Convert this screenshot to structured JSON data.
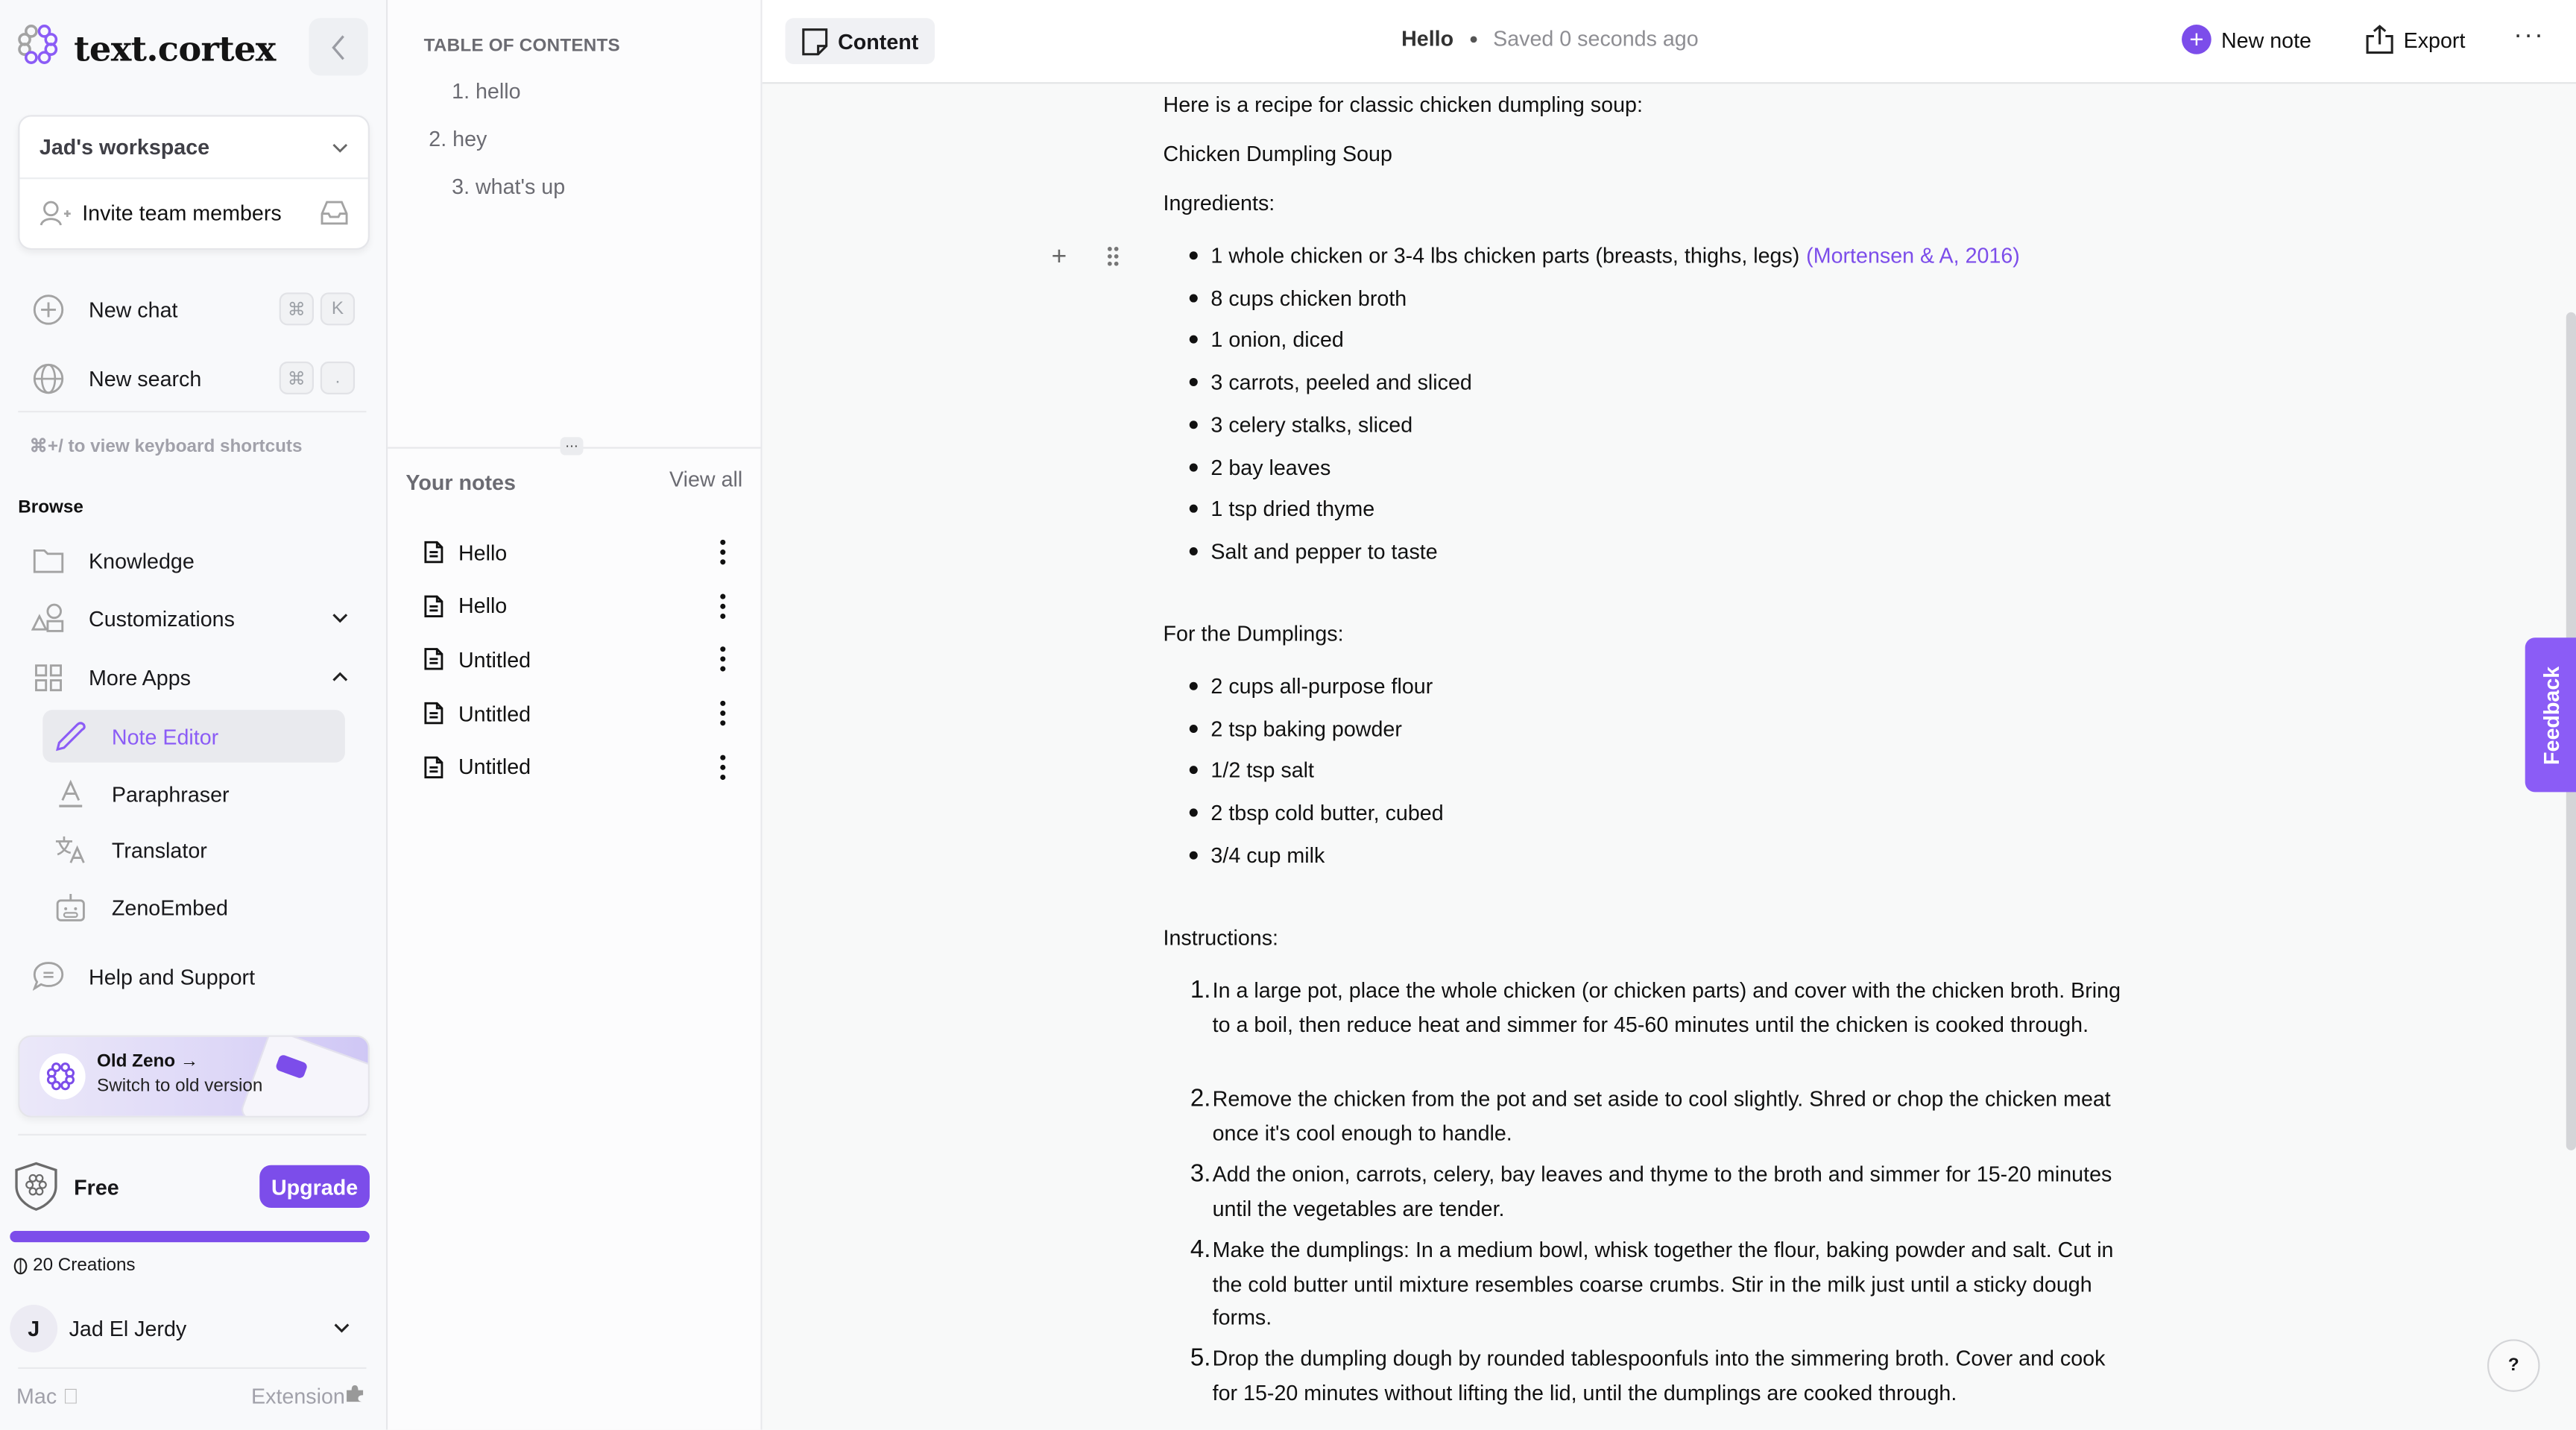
{
  "brand": {
    "name": "text.cortex",
    "accent": "#7c4dea"
  },
  "sidebar": {
    "workspace": "Jad's workspace",
    "invite_label": "Invite team members",
    "new_chat": {
      "label": "New chat",
      "keys": [
        "⌘",
        "K"
      ]
    },
    "new_search": {
      "label": "New search",
      "keys": [
        "⌘",
        "."
      ]
    },
    "shortcut_hint": "⌘+/ to view keyboard shortcuts",
    "browse_title": "Browse",
    "items": [
      {
        "label": "Knowledge",
        "icon": "folder-icon"
      },
      {
        "label": "Customizations",
        "icon": "shapes-icon"
      },
      {
        "label": "More Apps",
        "icon": "grid-icon"
      }
    ],
    "apps": [
      {
        "label": "Note Editor",
        "icon": "pencil-icon",
        "active": true
      },
      {
        "label": "Paraphraser",
        "icon": "text-a-icon"
      },
      {
        "label": "Translator",
        "icon": "translate-icon"
      },
      {
        "label": "ZenoEmbed",
        "icon": "robot-icon"
      }
    ],
    "help": "Help and Support",
    "old_zeno": {
      "title": "Old Zeno →",
      "subtitle": "Switch to old version"
    },
    "plan": {
      "label": "Free",
      "upgrade": "Upgrade",
      "usage_fraction": 1.0
    },
    "credits": "20 Creations",
    "user": {
      "initial": "J",
      "name": "Jad El Jerdy"
    },
    "footer": {
      "mac": "Mac",
      "extension": "Extension"
    }
  },
  "toc": {
    "title": "TABLE OF CONTENTS",
    "items": [
      "1. hello",
      "2. hey",
      "3. what's up"
    ]
  },
  "notes": {
    "title": "Your notes",
    "view_all": "View all",
    "items": [
      "Hello",
      "Hello",
      "Untitled",
      "Untitled",
      "Untitled"
    ]
  },
  "header": {
    "tab": "Content",
    "doc_title": "Hello",
    "saved": "Saved 0 seconds ago",
    "new_note": "New note",
    "export": "Export"
  },
  "document": {
    "intro": "Here is a recipe for classic chicken dumpling soup:",
    "title": "Chicken Dumpling Soup",
    "ingredients_heading": "Ingredients:",
    "ingredients": [
      "1 whole chicken or 3-4 lbs chicken parts (breasts, thighs, legs)",
      "8 cups chicken broth",
      "1 onion, diced",
      "3 carrots, peeled and sliced",
      "3 celery stalks, sliced",
      "2 bay leaves",
      "1 tsp dried thyme",
      "Salt and pepper to taste"
    ],
    "citation": "(Mortensen & A, 2016)",
    "dumplings_heading": "For the Dumplings:",
    "dumplings": [
      "2 cups all-purpose flour",
      "2 tsp baking powder",
      "1/2 tsp salt",
      "2 tbsp cold butter, cubed",
      "3/4 cup milk"
    ],
    "instructions_heading": "Instructions:",
    "instructions": [
      "In a large pot, place the whole chicken (or chicken parts) and cover with the chicken broth. Bring to a boil, then reduce heat and simmer for 45-60 minutes until the chicken is cooked through.",
      "Remove the chicken from the pot and set aside to cool slightly. Shred or chop the chicken meat once it's cool enough to handle.",
      "Add the onion, carrots, celery, bay leaves and thyme to the broth and simmer for 15-20 minutes until the vegetables are tender.",
      "Make the dumplings: In a medium bowl, whisk together the flour, baking powder and salt. Cut in the cold butter until mixture resembles coarse crumbs. Stir in the milk just until a sticky dough forms.",
      "Drop the dumpling dough by rounded tablespoonfuls into the simmering broth. Cover and cook for 15-20 minutes without lifting the lid, until the dumplings are cooked through."
    ]
  },
  "feedback_label": "Feedback",
  "help_label": "?"
}
